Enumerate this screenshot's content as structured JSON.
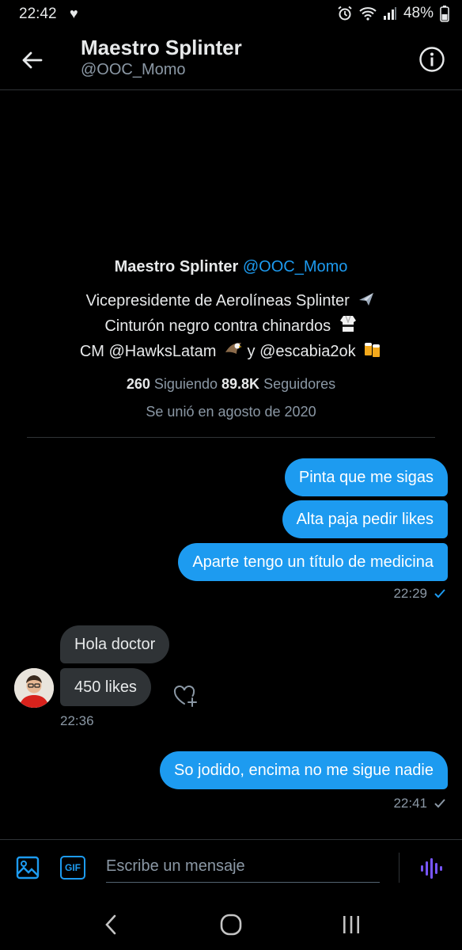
{
  "status_bar": {
    "time": "22:42",
    "battery": "48%"
  },
  "header": {
    "name": "Maestro Splinter",
    "handle": "@OOC_Momo"
  },
  "profile": {
    "name": "Maestro Splinter",
    "handle": "@OOC_Momo",
    "bio_line1": "Vicepresidente de Aerolíneas Splinter",
    "bio_line2": "Cinturón negro contra chinardos",
    "bio_line3_a": "CM @HawksLatam",
    "bio_line3_b": "y @escabia2ok",
    "following_count": "260",
    "following_label": "Siguiendo",
    "followers_count": "89.8K",
    "followers_label": "Seguidores",
    "joined": "Se unió en agosto de 2020"
  },
  "messages": [
    {
      "text": "Pinta que me sigas",
      "direction": "sent"
    },
    {
      "text": "Alta paja pedir likes",
      "direction": "sent"
    },
    {
      "text": "Aparte tengo un título de medicina",
      "direction": "sent",
      "time": "22:29"
    },
    {
      "text": "Hola doctor",
      "direction": "received"
    },
    {
      "text": "450 likes",
      "direction": "received",
      "time": "22:36"
    },
    {
      "text": "So jodido, encima no me sigue nadie",
      "direction": "sent",
      "time": "22:41"
    }
  ],
  "composer": {
    "placeholder": "Escribe un mensaje",
    "gif_label": "GIF"
  },
  "colors": {
    "accent": "#1d9bf0",
    "background": "#000000",
    "received_bubble": "#2f3336",
    "voice_icon": "#7856ff"
  },
  "icons": [
    "back-arrow-icon",
    "info-icon",
    "image-icon",
    "gif-icon",
    "voice-wave-icon",
    "heart-plus-icon",
    "check-icon",
    "airplane-emoji",
    "gi-emoji",
    "eagle-emoji",
    "beer-emoji",
    "nav-back-icon",
    "nav-home-icon",
    "nav-recents-icon"
  ]
}
